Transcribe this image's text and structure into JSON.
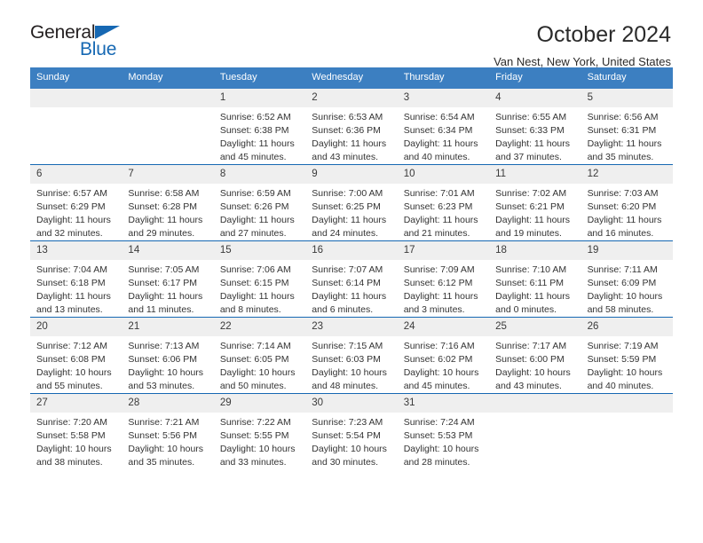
{
  "logo": {
    "word_top": "General",
    "word_bottom": "Blue",
    "triangle_color": "#1668b3",
    "text_color": "#231f20"
  },
  "header": {
    "title": "October 2024",
    "subtitle": "Van Nest, New York, United States"
  },
  "theme": {
    "header_band": "#3c7fc1",
    "week_divider": "#1668b3",
    "day_band": "#efefef"
  },
  "calendar": {
    "weekdays": [
      "Sunday",
      "Monday",
      "Tuesday",
      "Wednesday",
      "Thursday",
      "Friday",
      "Saturday"
    ],
    "weeks": [
      [
        {
          "day": "",
          "sunrise": "",
          "sunset": "",
          "daylight": ""
        },
        {
          "day": "",
          "sunrise": "",
          "sunset": "",
          "daylight": ""
        },
        {
          "day": "1",
          "sunrise": "Sunrise: 6:52 AM",
          "sunset": "Sunset: 6:38 PM",
          "daylight": "Daylight: 11 hours and 45 minutes."
        },
        {
          "day": "2",
          "sunrise": "Sunrise: 6:53 AM",
          "sunset": "Sunset: 6:36 PM",
          "daylight": "Daylight: 11 hours and 43 minutes."
        },
        {
          "day": "3",
          "sunrise": "Sunrise: 6:54 AM",
          "sunset": "Sunset: 6:34 PM",
          "daylight": "Daylight: 11 hours and 40 minutes."
        },
        {
          "day": "4",
          "sunrise": "Sunrise: 6:55 AM",
          "sunset": "Sunset: 6:33 PM",
          "daylight": "Daylight: 11 hours and 37 minutes."
        },
        {
          "day": "5",
          "sunrise": "Sunrise: 6:56 AM",
          "sunset": "Sunset: 6:31 PM",
          "daylight": "Daylight: 11 hours and 35 minutes."
        }
      ],
      [
        {
          "day": "6",
          "sunrise": "Sunrise: 6:57 AM",
          "sunset": "Sunset: 6:29 PM",
          "daylight": "Daylight: 11 hours and 32 minutes."
        },
        {
          "day": "7",
          "sunrise": "Sunrise: 6:58 AM",
          "sunset": "Sunset: 6:28 PM",
          "daylight": "Daylight: 11 hours and 29 minutes."
        },
        {
          "day": "8",
          "sunrise": "Sunrise: 6:59 AM",
          "sunset": "Sunset: 6:26 PM",
          "daylight": "Daylight: 11 hours and 27 minutes."
        },
        {
          "day": "9",
          "sunrise": "Sunrise: 7:00 AM",
          "sunset": "Sunset: 6:25 PM",
          "daylight": "Daylight: 11 hours and 24 minutes."
        },
        {
          "day": "10",
          "sunrise": "Sunrise: 7:01 AM",
          "sunset": "Sunset: 6:23 PM",
          "daylight": "Daylight: 11 hours and 21 minutes."
        },
        {
          "day": "11",
          "sunrise": "Sunrise: 7:02 AM",
          "sunset": "Sunset: 6:21 PM",
          "daylight": "Daylight: 11 hours and 19 minutes."
        },
        {
          "day": "12",
          "sunrise": "Sunrise: 7:03 AM",
          "sunset": "Sunset: 6:20 PM",
          "daylight": "Daylight: 11 hours and 16 minutes."
        }
      ],
      [
        {
          "day": "13",
          "sunrise": "Sunrise: 7:04 AM",
          "sunset": "Sunset: 6:18 PM",
          "daylight": "Daylight: 11 hours and 13 minutes."
        },
        {
          "day": "14",
          "sunrise": "Sunrise: 7:05 AM",
          "sunset": "Sunset: 6:17 PM",
          "daylight": "Daylight: 11 hours and 11 minutes."
        },
        {
          "day": "15",
          "sunrise": "Sunrise: 7:06 AM",
          "sunset": "Sunset: 6:15 PM",
          "daylight": "Daylight: 11 hours and 8 minutes."
        },
        {
          "day": "16",
          "sunrise": "Sunrise: 7:07 AM",
          "sunset": "Sunset: 6:14 PM",
          "daylight": "Daylight: 11 hours and 6 minutes."
        },
        {
          "day": "17",
          "sunrise": "Sunrise: 7:09 AM",
          "sunset": "Sunset: 6:12 PM",
          "daylight": "Daylight: 11 hours and 3 minutes."
        },
        {
          "day": "18",
          "sunrise": "Sunrise: 7:10 AM",
          "sunset": "Sunset: 6:11 PM",
          "daylight": "Daylight: 11 hours and 0 minutes."
        },
        {
          "day": "19",
          "sunrise": "Sunrise: 7:11 AM",
          "sunset": "Sunset: 6:09 PM",
          "daylight": "Daylight: 10 hours and 58 minutes."
        }
      ],
      [
        {
          "day": "20",
          "sunrise": "Sunrise: 7:12 AM",
          "sunset": "Sunset: 6:08 PM",
          "daylight": "Daylight: 10 hours and 55 minutes."
        },
        {
          "day": "21",
          "sunrise": "Sunrise: 7:13 AM",
          "sunset": "Sunset: 6:06 PM",
          "daylight": "Daylight: 10 hours and 53 minutes."
        },
        {
          "day": "22",
          "sunrise": "Sunrise: 7:14 AM",
          "sunset": "Sunset: 6:05 PM",
          "daylight": "Daylight: 10 hours and 50 minutes."
        },
        {
          "day": "23",
          "sunrise": "Sunrise: 7:15 AM",
          "sunset": "Sunset: 6:03 PM",
          "daylight": "Daylight: 10 hours and 48 minutes."
        },
        {
          "day": "24",
          "sunrise": "Sunrise: 7:16 AM",
          "sunset": "Sunset: 6:02 PM",
          "daylight": "Daylight: 10 hours and 45 minutes."
        },
        {
          "day": "25",
          "sunrise": "Sunrise: 7:17 AM",
          "sunset": "Sunset: 6:00 PM",
          "daylight": "Daylight: 10 hours and 43 minutes."
        },
        {
          "day": "26",
          "sunrise": "Sunrise: 7:19 AM",
          "sunset": "Sunset: 5:59 PM",
          "daylight": "Daylight: 10 hours and 40 minutes."
        }
      ],
      [
        {
          "day": "27",
          "sunrise": "Sunrise: 7:20 AM",
          "sunset": "Sunset: 5:58 PM",
          "daylight": "Daylight: 10 hours and 38 minutes."
        },
        {
          "day": "28",
          "sunrise": "Sunrise: 7:21 AM",
          "sunset": "Sunset: 5:56 PM",
          "daylight": "Daylight: 10 hours and 35 minutes."
        },
        {
          "day": "29",
          "sunrise": "Sunrise: 7:22 AM",
          "sunset": "Sunset: 5:55 PM",
          "daylight": "Daylight: 10 hours and 33 minutes."
        },
        {
          "day": "30",
          "sunrise": "Sunrise: 7:23 AM",
          "sunset": "Sunset: 5:54 PM",
          "daylight": "Daylight: 10 hours and 30 minutes."
        },
        {
          "day": "31",
          "sunrise": "Sunrise: 7:24 AM",
          "sunset": "Sunset: 5:53 PM",
          "daylight": "Daylight: 10 hours and 28 minutes."
        },
        {
          "day": "",
          "sunrise": "",
          "sunset": "",
          "daylight": ""
        },
        {
          "day": "",
          "sunrise": "",
          "sunset": "",
          "daylight": ""
        }
      ]
    ]
  }
}
